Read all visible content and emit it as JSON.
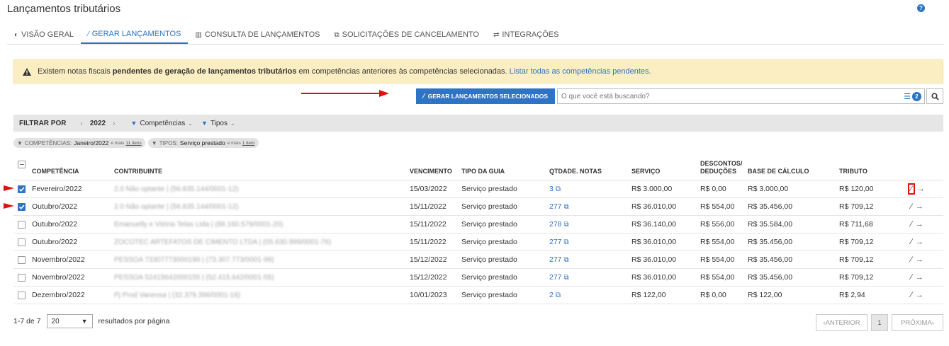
{
  "page": {
    "title": "Lançamentos tributários",
    "help_icon": "?"
  },
  "tabs": [
    {
      "icon": "◐",
      "label": "VISÃO GERAL",
      "active": false
    },
    {
      "icon": "⁄",
      "label": "GERAR LANÇAMENTOS",
      "active": true
    },
    {
      "icon": "▥",
      "label": "CONSULTA DE LANÇAMENTOS",
      "active": false
    },
    {
      "icon": "⧉",
      "label": "SOLICITAÇÕES DE CANCELAMENTO",
      "active": false
    },
    {
      "icon": "⇄",
      "label": "INTEGRAÇÕES",
      "active": false
    }
  ],
  "alert": {
    "text_before": "Existem notas fiscais",
    "bold": "pendentes de geração de lançamentos tributários",
    "text_after": "em competências anteriores às competências selecionadas.",
    "link": "Listar todas as competências pendentes."
  },
  "actions": {
    "generate_label": "GERAR LANÇAMENTOS SELECIONADOS",
    "search_placeholder": "O que você está buscando?",
    "filter_count": "2"
  },
  "filterbar": {
    "label": "FILTRAR POR",
    "prev": "‹",
    "year": "2022",
    "next": "›",
    "competencias": "Competências",
    "tipos": "Tipos"
  },
  "chips": [
    {
      "label": "COMPETÊNCIAS:",
      "value": "Janeiro/2022",
      "more": "e mais",
      "more_link": "11 itens"
    },
    {
      "label": "TIPOS:",
      "value": "Serviço prestado",
      "more": "e mais",
      "more_link": "1 item"
    }
  ],
  "table": {
    "headers": {
      "competencia": "COMPETÊNCIA",
      "contribuinte": "CONTRIBUINTE",
      "vencimento": "VENCIMENTO",
      "tipo": "TIPO DA GUIA",
      "qtde": "QTDADE. NOTAS",
      "servico": "SERVIÇO",
      "descontos_1": "DESCONTOS/",
      "descontos_2": "DEDUÇÕES",
      "base": "BASE DE CÁLCULO",
      "tributo": "TRIBUTO"
    },
    "rows": [
      {
        "checked": true,
        "competencia": "Fevereiro/2022",
        "contribuinte": "2.0 Não optante | (56.835.144/0001-12)",
        "vencimento": "15/03/2022",
        "tipo": "Serviço prestado",
        "qtde": "3",
        "servico": "R$ 3.000,00",
        "descontos": "R$ 0,00",
        "base": "R$ 3.000,00",
        "tributo": "R$ 120,00"
      },
      {
        "checked": true,
        "competencia": "Outubro/2022",
        "contribuinte": "2.0 Não optante | (56.835.144/0001-12)",
        "vencimento": "15/11/2022",
        "tipo": "Serviço prestado",
        "qtde": "277",
        "servico": "R$ 36.010,00",
        "descontos": "R$ 554,00",
        "base": "R$ 35.456,00",
        "tributo": "R$ 709,12"
      },
      {
        "checked": false,
        "competencia": "Outubro/2022",
        "contribuinte": "Emanuelly e Vitória Telas Ltda | (88.160.579/0001-20)",
        "vencimento": "15/11/2022",
        "tipo": "Serviço prestado",
        "qtde": "278",
        "servico": "R$ 36.140,00",
        "descontos": "R$ 556,00",
        "base": "R$ 35.584,00",
        "tributo": "R$ 711,68"
      },
      {
        "checked": false,
        "competencia": "Outubro/2022",
        "contribuinte": "ZOCOTEC ARTEFATOS DE CIMENTO LTDA | (05.630.999/0001-76)",
        "vencimento": "15/11/2022",
        "tipo": "Serviço prestado",
        "qtde": "277",
        "servico": "R$ 36.010,00",
        "descontos": "R$ 554,00",
        "base": "R$ 35.456,00",
        "tributo": "R$ 709,12"
      },
      {
        "checked": false,
        "competencia": "Novembro/2022",
        "contribuinte": "PESSOA 73307773000199 | (73.307.773/0001-99)",
        "vencimento": "15/12/2022",
        "tipo": "Serviço prestado",
        "qtde": "277",
        "servico": "R$ 36.010,00",
        "descontos": "R$ 554,00",
        "base": "R$ 35.456,00",
        "tributo": "R$ 709,12"
      },
      {
        "checked": false,
        "competencia": "Novembro/2022",
        "contribuinte": "PESSOA 52415642000155 | (52.415.642/0001-55)",
        "vencimento": "15/12/2022",
        "tipo": "Serviço prestado",
        "qtde": "277",
        "servico": "R$ 36.010,00",
        "descontos": "R$ 554,00",
        "base": "R$ 35.456,00",
        "tributo": "R$ 709,12"
      },
      {
        "checked": false,
        "competencia": "Dezembro/2022",
        "contribuinte": "Pj Prod Vanessa | (32.379.396/0001-16)",
        "vencimento": "10/01/2023",
        "tipo": "Serviço prestado",
        "qtde": "2",
        "servico": "R$ 122,00",
        "descontos": "R$ 0,00",
        "base": "R$ 122,00",
        "tributo": "R$ 2,94"
      }
    ]
  },
  "pager": {
    "range": "1-7 de 7",
    "page_size": "20",
    "per_page_label": "resultados por página",
    "prev": "‹ANTERIOR",
    "current": "1",
    "next": "PRÓXIMA›"
  },
  "colors": {
    "primary": "#2f73c4",
    "alert_bg": "#fbeec2",
    "annotation": "#e01010"
  }
}
